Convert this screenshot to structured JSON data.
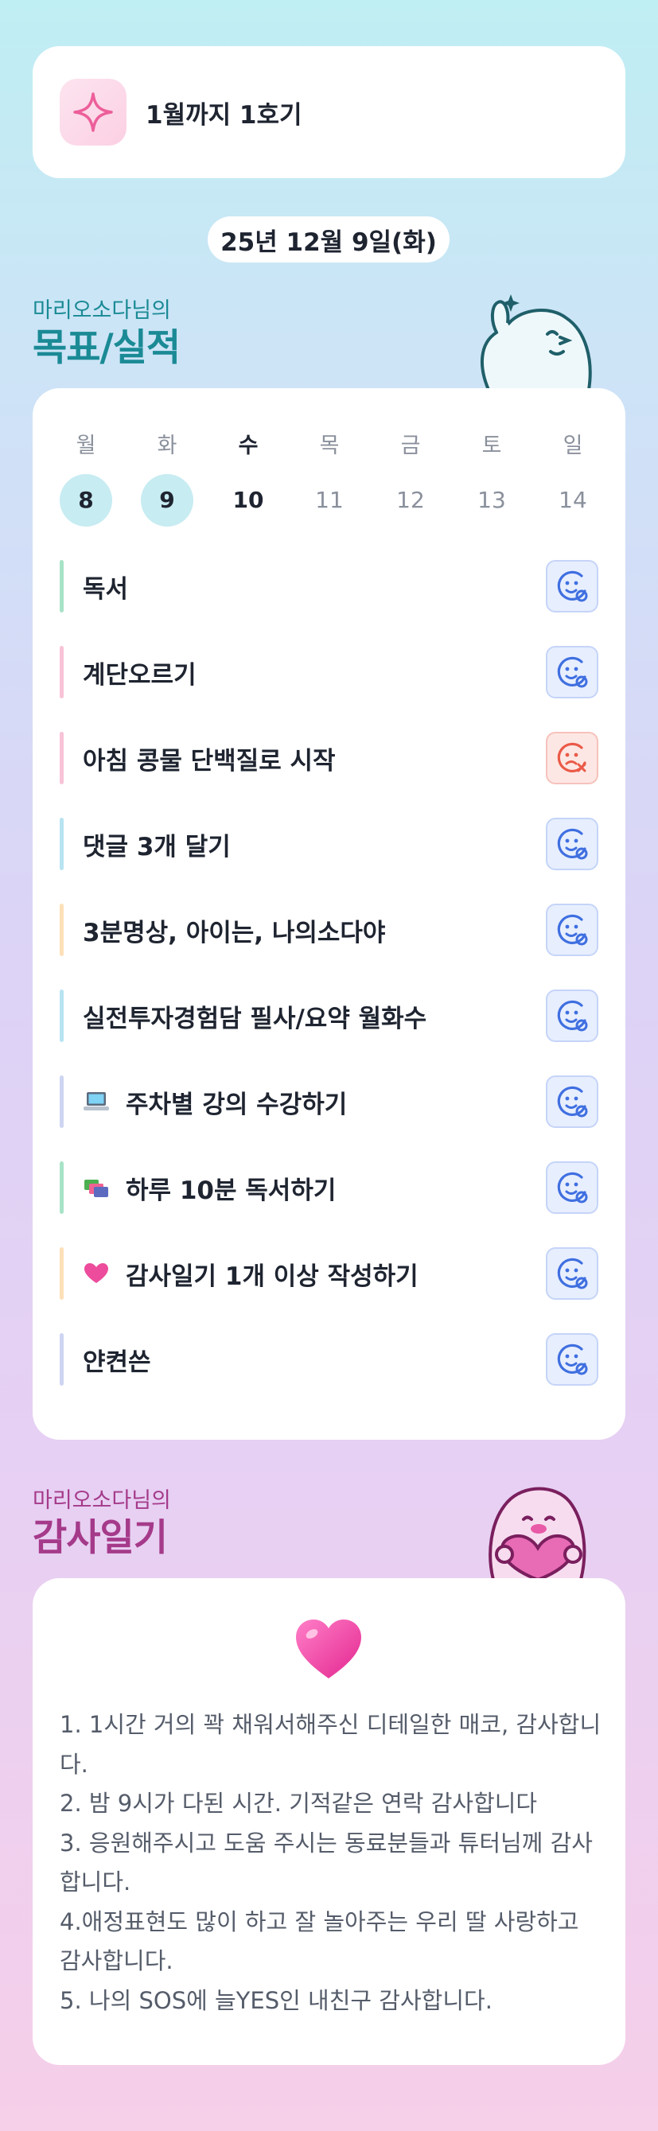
{
  "header": {
    "title": "1월까지 1호기",
    "icon": "sparkle-icon"
  },
  "date": "25년 12월 9일(화)",
  "goals_section": {
    "owner": "마리오소다님의",
    "title": "목표/실적"
  },
  "week": {
    "days": [
      {
        "name": "월",
        "num": "8",
        "state": "done"
      },
      {
        "name": "화",
        "num": "9",
        "state": "done"
      },
      {
        "name": "수",
        "num": "10",
        "state": "today"
      },
      {
        "name": "목",
        "num": "11",
        "state": "future"
      },
      {
        "name": "금",
        "num": "12",
        "state": "future"
      },
      {
        "name": "토",
        "num": "13",
        "state": "future"
      },
      {
        "name": "일",
        "num": "14",
        "state": "future"
      }
    ]
  },
  "goals": [
    {
      "label": "독서",
      "bar_color": "#a8e3c8",
      "status": "success",
      "emoji": ""
    },
    {
      "label": "계단오르기",
      "bar_color": "#f8c3d7",
      "status": "success",
      "emoji": ""
    },
    {
      "label": "아침 콩물 단백질로 시작",
      "bar_color": "#f8c3d7",
      "status": "fail",
      "emoji": ""
    },
    {
      "label": "댓글 3개 달기",
      "bar_color": "#b8e3f1",
      "status": "success",
      "emoji": ""
    },
    {
      "label": "3분명상, 아이는, 나의소다야",
      "bar_color": "#fde0b8",
      "status": "success",
      "emoji": ""
    },
    {
      "label": "실전투자경험담 필사/요약 월화수",
      "bar_color": "#b8e3f1",
      "status": "success",
      "emoji": ""
    },
    {
      "label": "주차별 강의 수강하기",
      "bar_color": "#cdd5f2",
      "status": "success",
      "emoji": "laptop-icon"
    },
    {
      "label": "하루 10분 독서하기",
      "bar_color": "#a8e3c8",
      "status": "success",
      "emoji": "books-icon"
    },
    {
      "label": "감사일기 1개 이상 작성하기",
      "bar_color": "#fde0b8",
      "status": "success",
      "emoji": "heart-icon"
    },
    {
      "label": "얀켠쓴",
      "bar_color": "#cdd5f2",
      "status": "success",
      "emoji": ""
    }
  ],
  "gratitude_section": {
    "owner": "마리오소다님의",
    "title": "감사일기"
  },
  "gratitude": {
    "icon": "heart-icon",
    "lines": [
      "1. 1시간 거의 꽉 채워서해주신 디테일한 매코, 감사합니다.",
      "2. 밤 9시가 다된 시간. 기적같은 연락 감사합니다",
      "3. 응원해주시고 도움 주시는 동료분들과 튜터님께 감사합니다.",
      "4.애정표현도 많이 하고 잘 놀아주는 우리 딸 사랑하고 감사합니다.",
      "5. 나의 SOS에 늘YES인 내친구 감사합니다."
    ]
  },
  "colors": {
    "goals_title": "#1a8a95",
    "gratitude_title": "#a53a8a",
    "success": "#3f6fe0",
    "fail": "#ea5a48"
  }
}
